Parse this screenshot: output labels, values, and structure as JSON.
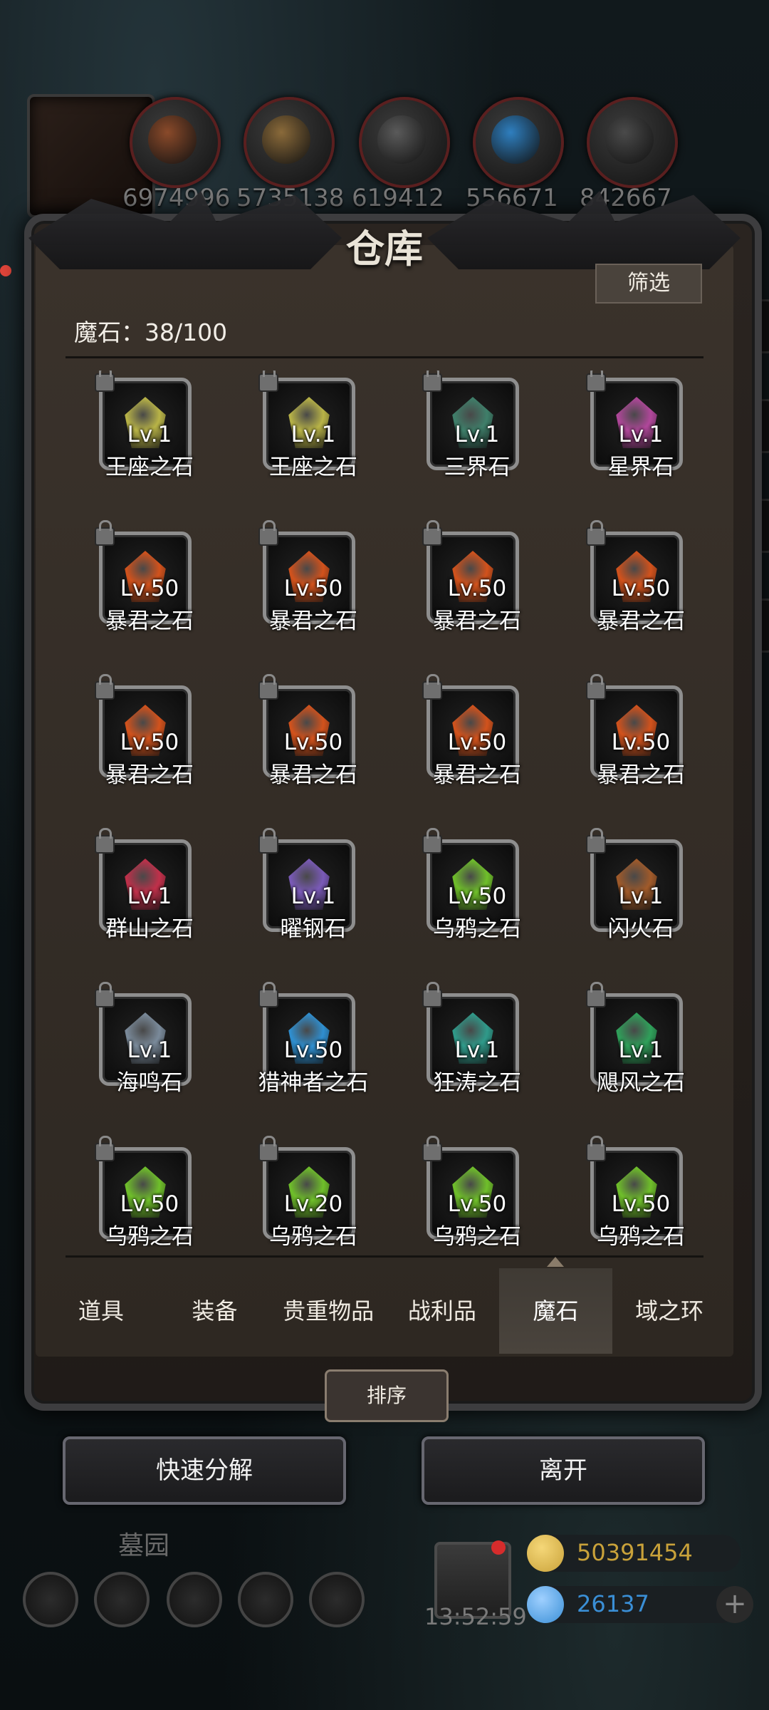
{
  "resources": [
    {
      "icon": "meat-icon",
      "value": "6974996",
      "color": "#8a4a2a"
    },
    {
      "icon": "wood-icon",
      "value": "5735138",
      "color": "#8a6a3a"
    },
    {
      "icon": "stone-icon",
      "value": "619412",
      "color": "#5a5a5a"
    },
    {
      "icon": "crystal-icon",
      "value": "556671",
      "color": "#2f7fbf"
    },
    {
      "icon": "iron-icon",
      "value": "842667",
      "color": "#4a4a4a"
    }
  ],
  "panel": {
    "title": "仓库",
    "filter_label": "筛选",
    "count_label": "魔石：38/100"
  },
  "items": [
    {
      "lv": "Lv.1",
      "name": "王座之石",
      "color": "#b8b347"
    },
    {
      "lv": "Lv.1",
      "name": "王座之石",
      "color": "#b8b347"
    },
    {
      "lv": "Lv.1",
      "name": "三界石",
      "color": "#3f7f6a"
    },
    {
      "lv": "Lv.1",
      "name": "星界石",
      "color": "#b0479a"
    },
    {
      "lv": "Lv.50",
      "name": "暴君之石",
      "color": "#d2521c"
    },
    {
      "lv": "Lv.50",
      "name": "暴君之石",
      "color": "#d2521c"
    },
    {
      "lv": "Lv.50",
      "name": "暴君之石",
      "color": "#d2521c"
    },
    {
      "lv": "Lv.50",
      "name": "暴君之石",
      "color": "#d2521c"
    },
    {
      "lv": "Lv.50",
      "name": "暴君之石",
      "color": "#d2521c"
    },
    {
      "lv": "Lv.50",
      "name": "暴君之石",
      "color": "#d2521c"
    },
    {
      "lv": "Lv.50",
      "name": "暴君之石",
      "color": "#d2521c"
    },
    {
      "lv": "Lv.50",
      "name": "暴君之石",
      "color": "#d2521c"
    },
    {
      "lv": "Lv.1",
      "name": "群山之石",
      "color": "#c0304a"
    },
    {
      "lv": "Lv.1",
      "name": "曜钢石",
      "color": "#7a5ab8"
    },
    {
      "lv": "Lv.50",
      "name": "乌鸦之石",
      "color": "#6fbf2a"
    },
    {
      "lv": "Lv.1",
      "name": "闪火石",
      "color": "#a05a2a"
    },
    {
      "lv": "Lv.1",
      "name": "海鸣石",
      "color": "#7a8a9a"
    },
    {
      "lv": "Lv.50",
      "name": "猎神者之石",
      "color": "#2f8fd0"
    },
    {
      "lv": "Lv.1",
      "name": "狂涛之石",
      "color": "#2f9a8a"
    },
    {
      "lv": "Lv.1",
      "name": "飓风之石",
      "color": "#2fa05a"
    },
    {
      "lv": "Lv.50",
      "name": "乌鸦之石",
      "color": "#6fbf2a"
    },
    {
      "lv": "Lv.20",
      "name": "乌鸦之石",
      "color": "#6fbf2a"
    },
    {
      "lv": "Lv.50",
      "name": "乌鸦之石",
      "color": "#6fbf2a"
    },
    {
      "lv": "Lv.50",
      "name": "乌鸦之石",
      "color": "#6fbf2a"
    }
  ],
  "tabs": [
    "道具",
    "装备",
    "贵重物品",
    "战利品",
    "魔石",
    "域之环"
  ],
  "active_tab": "魔石",
  "sort_label": "排序",
  "quick_decompose_label": "快速分解",
  "leave_label": "离开",
  "scene_label": "墓园",
  "timer": "13:52:59",
  "gold": {
    "value": "50391454",
    "color": "#c9a23a"
  },
  "gems": {
    "value": "26137",
    "color": "#3a8fd6"
  }
}
